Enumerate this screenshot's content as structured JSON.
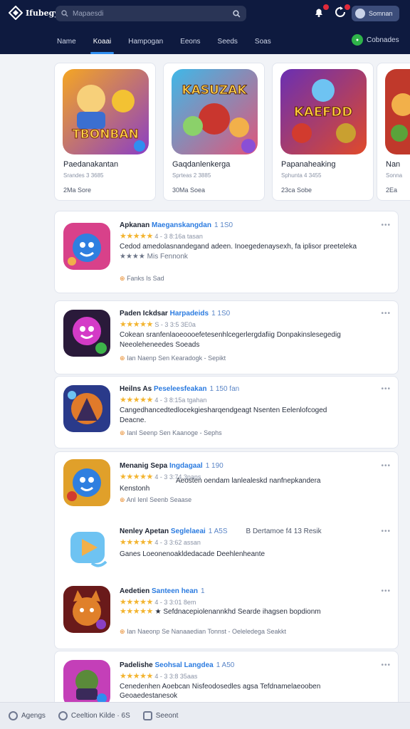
{
  "header": {
    "logo_text": "Ifubegy",
    "search_placeholder": "Mapaesdi",
    "account_label": "Somnan",
    "nav_tabs": [
      {
        "label": "Name",
        "active": false
      },
      {
        "label": "Koaai",
        "active": true
      },
      {
        "label": "Hampogan",
        "active": false
      },
      {
        "label": "Eeons",
        "active": false
      },
      {
        "label": "Seeds",
        "active": false
      },
      {
        "label": "Soas",
        "active": false
      }
    ],
    "nav_right_label": "Cobnades"
  },
  "featured": [
    {
      "title": "Paedanakantan",
      "subtitle": "Srandes 3 3685",
      "meta": "2Ma  Sore",
      "art_text": "TBONBAN"
    },
    {
      "title": "Gaqdanlenkerga",
      "subtitle": "Sprteas 2 3885",
      "meta": "30Ma  Soea",
      "art_text": "KASUZAK"
    },
    {
      "title": "Papanaheaking",
      "subtitle": "Sphunta 4 3455",
      "meta": "23ca  Sobe",
      "art_text": "KAEFDD"
    },
    {
      "title": "Nan",
      "subtitle": "Sonna",
      "meta": "2Ea",
      "art_text": ""
    }
  ],
  "apps": [
    {
      "name": "Apkanan",
      "publisher": "Maeganskangdan",
      "size": "1 1S0",
      "rating": "4 - 3 8:16a tasan",
      "desc": "Cedod amedolasnandegand adeen. Inoegedenaysexh, fa iplisor preeteleka",
      "desc2": "★★★★ Mis Fennonk",
      "tags": "Fanks   Is Sad"
    },
    {
      "name": "Paden Ickdsar",
      "publisher": "Harpadeids",
      "size": "1 1S0",
      "rating": "S - 3 3:5 3E0a",
      "desc": "Cokean sranfenlaoeoooefetesenhlcegerlergdafiig Donpakinslesegedig",
      "desc2": "Neeoleheneedes Soeads",
      "tags": "Ian Naenp   Sen Kearadogk - Sepikt"
    },
    {
      "name": "Heilns As",
      "publisher": "Peseleesfeakan",
      "size": "1 150  fan",
      "rating": "4 - 3 8:15a tgahan",
      "desc": "Cangedhancedtedlocekgiesharqendgeagt Nsenten Eelenlofcoged",
      "desc2": "Deacne.",
      "tags": "Ianl Seenp   Sen Kaanoge - Sephs"
    },
    {
      "name": "Menanig Sepa",
      "publisher": "Ingdagaal",
      "size": "1 190",
      "rating": "4 - 3 3:74 3pans",
      "desc": "Aeosten oendam lanlealeskd nanfnepkandera",
      "desc2": "Kenstonh",
      "tags": "Anl Ienl Seenb   Seaase"
    },
    {
      "name": "Nenley Apetan",
      "publisher": "Seglelaeai",
      "size": "1 A5S",
      "rating": "4 - 3 3:62 assan",
      "desc": "Ganes Loeonenoakldedacade Deehlenheante",
      "desc2": "B Dertamoe f4 13 Resik",
      "tags": ""
    },
    {
      "name": "Aedetien",
      "publisher": "Santeen hean",
      "size": "1",
      "rating": "4 - 3 3:01 8em",
      "desc": "★ Sefdnacepiolenannkhd Searde ihagsen bopdionm",
      "desc2": "",
      "tags": "Ian Naeonp   Se Nanaaedian Tonnst - Oeleledega Seakkt"
    },
    {
      "name": "Padelishe",
      "publisher": "Seohsal Langdea",
      "size": "1 A50",
      "rating": "4 - 3 3:8 35aas",
      "desc": "Cenedenhen Aoebcan Nisfeodosedles agsa Tefdnamelaeooben",
      "desc2": "Geoaedestanesok",
      "tags": ""
    }
  ],
  "bottom_bar": [
    {
      "label": "Agengs"
    },
    {
      "label": "Ceeltion Kilde · 6S"
    },
    {
      "label": "Seeont"
    }
  ],
  "colors": {
    "header_bg": "#0e1a3f",
    "accent": "#2f8ef0",
    "star": "#f3b42f",
    "publisher": "#2b7be0"
  }
}
